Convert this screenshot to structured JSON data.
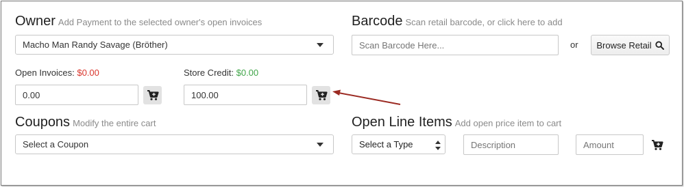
{
  "owner": {
    "title": "Owner",
    "subtitle": "Add Payment to the selected owner's open invoices",
    "selected": "Macho Man Randy Savage (Bröther)"
  },
  "barcode": {
    "title": "Barcode",
    "subtitle": "Scan retail barcode, or click here to add",
    "placeholder": "Scan Barcode Here...",
    "or_text": "or",
    "browse_label": "Browse Retail"
  },
  "open_invoices": {
    "label": "Open Invoices:",
    "amount": "$0.00",
    "value": "0.00",
    "amount_color": "#d9342b"
  },
  "store_credit": {
    "label": "Store Credit:",
    "amount": "$0.00",
    "value": "100.00",
    "amount_color": "#3fa548"
  },
  "coupons": {
    "title": "Coupons",
    "subtitle": "Modify the entire cart",
    "selected": "Select a Coupon"
  },
  "open_line_items": {
    "title": "Open Line Items",
    "subtitle": "Add open price item to cart",
    "type_selected": "Select a Type",
    "description_placeholder": "Description",
    "amount_placeholder": "Amount"
  },
  "icons": {
    "cart": "cart-plus-icon",
    "search": "search-icon",
    "caret": "caret-down-icon",
    "annotation": "red-arrow-annotation"
  },
  "annotation_color": "#9b2a22"
}
